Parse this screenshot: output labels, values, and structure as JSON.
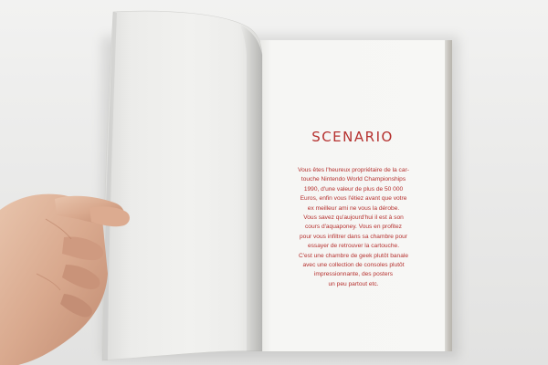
{
  "page": {
    "title": "SCENARIO",
    "text_color": "#b5302e",
    "paragraph": [
      "Vous êtes l'heureux propriétaire de la car-",
      "touche Nintendo World Championships",
      "1990, d'une valeur de plus de 50 000",
      "Euros, enfin vous l'étiez avant que votre",
      "ex meilleur ami ne vous la dérobe.",
      "Vous savez qu'aujourd'hui il est à son",
      "cours d'aquaponey. Vous en profitez",
      "pour vous infiltrer dans sa chambre pour",
      "essayer de retrouver la cartouche.",
      "C'est une chambre de geek plutôt banale",
      "avec une collection de consoles plutôt",
      "impressionnante, des posters",
      "un peu partout etc."
    ]
  }
}
